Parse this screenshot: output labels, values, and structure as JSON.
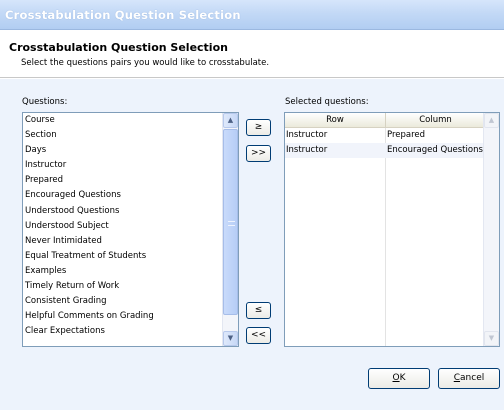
{
  "window": {
    "title": "Crosstabulation Question Selection"
  },
  "header": {
    "title": "Crosstabulation Question Selection",
    "subtitle": "Select the questions pairs you would like to crosstabulate."
  },
  "questions": {
    "label": "Questions:",
    "items": [
      "Course",
      "Section",
      "Days",
      "Instructor",
      "Prepared",
      "Encouraged Questions",
      "Understood Questions",
      "Understood Subject",
      "Never Intimidated",
      "Equal Treatment of Students",
      "Examples",
      "Timely Return of Work",
      "Consistent Grading",
      "Helpful Comments on Grading",
      "Clear Expectations"
    ]
  },
  "move_buttons": {
    "add": "≥",
    "add_all": ">>",
    "remove": "≤",
    "remove_all": "<<"
  },
  "selected": {
    "label": "Selected questions:",
    "columns": [
      "Row",
      "Column"
    ],
    "rows": [
      {
        "row": "Instructor",
        "column": "Prepared"
      },
      {
        "row": "Instructor",
        "column": "Encouraged Questions"
      }
    ]
  },
  "dialog_buttons": {
    "ok_mnemonic": "O",
    "ok_rest": "K",
    "cancel_mnemonic": "C",
    "cancel_rest": "ancel"
  },
  "icons": {
    "scroll_up": "chevron-up-icon",
    "scroll_down": "chevron-down-icon"
  }
}
